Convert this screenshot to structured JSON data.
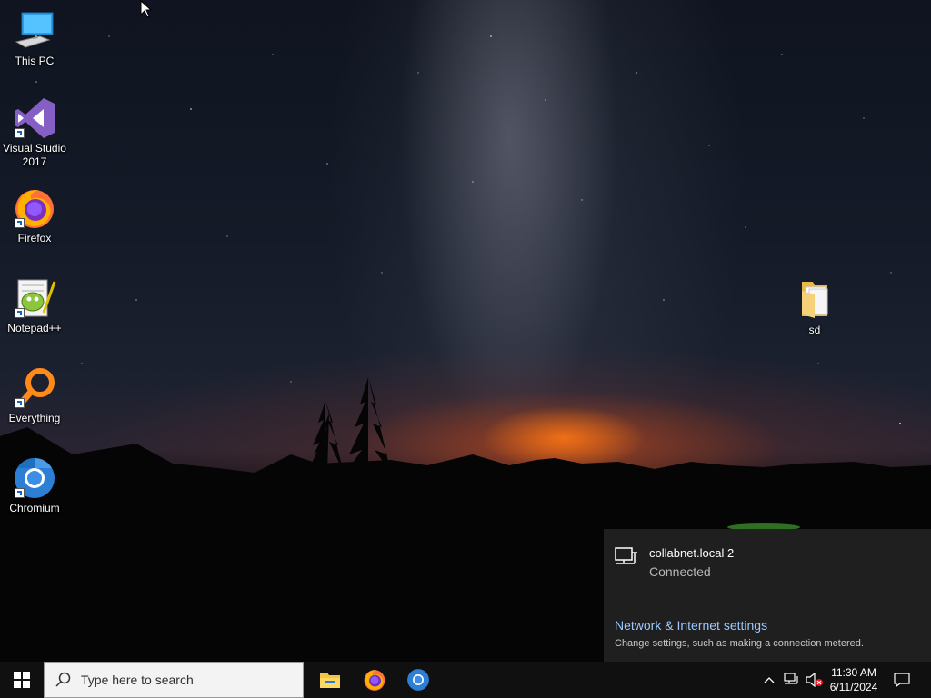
{
  "desktop": {
    "icons": [
      {
        "label": "This PC",
        "icon": "this-pc-icon",
        "shortcut": false
      },
      {
        "label": "Visual Studio 2017",
        "icon": "visual-studio-icon",
        "shortcut": true
      },
      {
        "label": "Firefox",
        "icon": "firefox-icon",
        "shortcut": true
      },
      {
        "label": "Notepad++",
        "icon": "notepadpp-icon",
        "shortcut": true
      },
      {
        "label": "Everything",
        "icon": "everything-icon",
        "shortcut": true
      },
      {
        "label": "Chromium",
        "icon": "chromium-icon",
        "shortcut": true
      },
      {
        "label": "sd",
        "icon": "folder-icon",
        "shortcut": false
      }
    ]
  },
  "network_flyout": {
    "network_name": "collabnet.local 2",
    "status": "Connected",
    "settings_link": "Network & Internet settings",
    "settings_description": "Change settings, such as making a connection metered."
  },
  "taskbar": {
    "search_placeholder": "Type here to search",
    "pinned_apps": [
      {
        "name": "File Explorer",
        "icon": "file-explorer-icon"
      },
      {
        "name": "Firefox",
        "icon": "firefox-icon"
      },
      {
        "name": "Chromium",
        "icon": "chromium-icon"
      }
    ],
    "tray": {
      "time": "11:30 AM",
      "date": "6/11/2024",
      "icons": [
        "chevron-up-icon",
        "network-icon",
        "volume-muted-icon",
        "notification-icon"
      ]
    }
  },
  "colors": {
    "taskbar_bg": "#101010",
    "flyout_bg": "#202020",
    "link_color": "#9cc8ff",
    "search_bg": "#f3f3f3"
  }
}
